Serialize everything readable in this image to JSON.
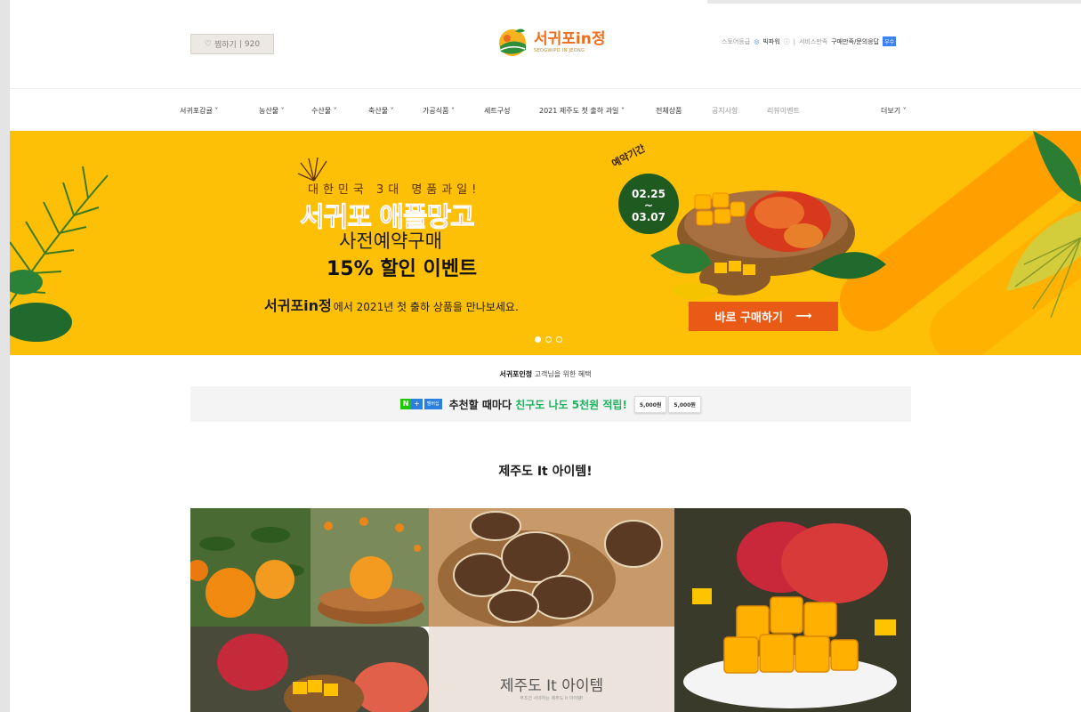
{
  "header": {
    "favorite": {
      "label": "찜하기",
      "count": "920"
    },
    "logo": {
      "name": "서귀포in정",
      "sub": "SEOGWIPO IN JEONG"
    },
    "util": {
      "store_grade": "스토어등급",
      "grade_name": "빅파워",
      "grade_info": "ⓘ",
      "sep": "|",
      "service": "서비스만족",
      "purchase": "구매만족/문의응답",
      "badge": "우수"
    }
  },
  "nav": {
    "items": [
      {
        "label": "서귀포감귤 ˅"
      },
      {
        "label": "농산물 ˅"
      },
      {
        "label": "수산물 ˅"
      },
      {
        "label": "축산물 ˅"
      },
      {
        "label": "가공식품 ˅"
      },
      {
        "label": "세트구성"
      },
      {
        "label": "2021 제주도 첫 출하 과일 ˅"
      },
      {
        "label": "전체상품"
      },
      {
        "label": "공지사항"
      },
      {
        "label": "리뷰이벤트"
      },
      {
        "label": "더보기 ˅"
      }
    ]
  },
  "hero": {
    "kicker": "대한민국 3대 명품과일!",
    "title": "서귀포 애플망고",
    "sub1": "사전예약구매",
    "sub2": "15% 할인 이벤트",
    "foot_brand": "서귀포in정",
    "foot_rest": "에서 2021년 첫 출하 상품을 만나보세요.",
    "period_label": "예약기간",
    "period_start": "02.25",
    "period_tilde": "~",
    "period_end": "03.07",
    "cta": "바로 구매하기",
    "cta_arrow": "⟶"
  },
  "benefit": {
    "title_bold": "서귀포인정",
    "title_rest": " 고객님을 위한 혜택",
    "n": "N",
    "plus": "+",
    "membership": "멤버십",
    "text": "추천할 때마다 ",
    "highlight": "친구도 나도 5천원 적립!",
    "coupon1": "5,000원",
    "coupon2": "5,000원"
  },
  "section": {
    "title": "제주도 It 아이템!",
    "card_title": "제주도 It 아이템",
    "card_sub": "무조건 사야하는 제주도 It 아이템!"
  },
  "colors": {
    "hero_bg": "#fec007",
    "accent_orange": "#e85a16",
    "benefit_green": "#21b25f"
  }
}
